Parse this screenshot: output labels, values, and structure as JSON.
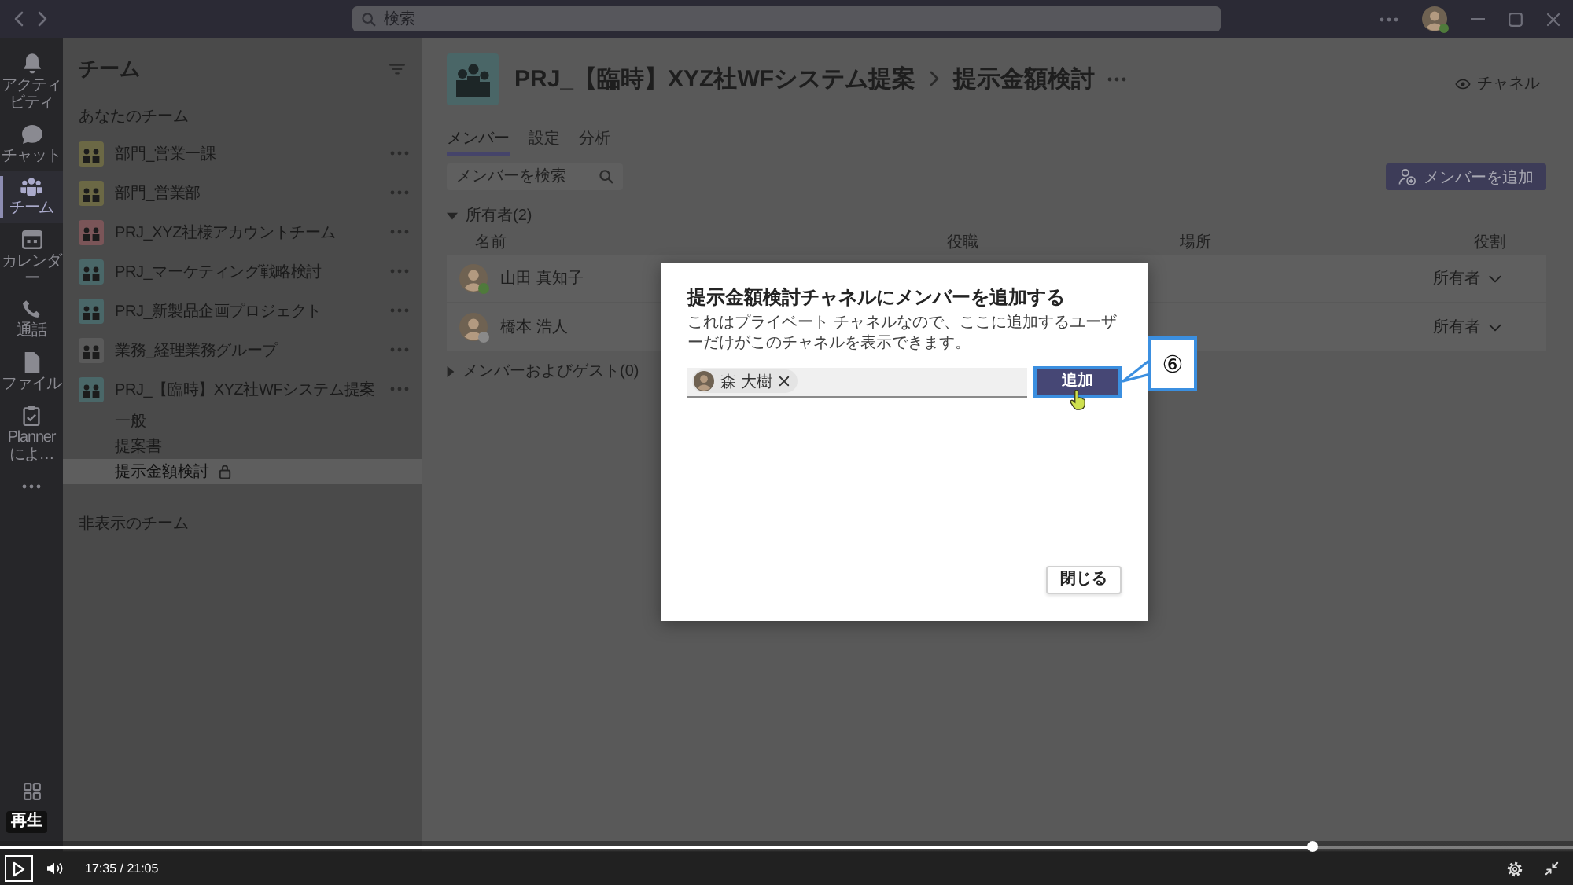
{
  "title_bar": {
    "search": {
      "placeholder": "検索"
    },
    "profile": {
      "color": "#4f7a3b"
    }
  },
  "app_bar": {
    "items": [
      {
        "label": "アクティビティ",
        "selected": false
      },
      {
        "label": "チャット",
        "selected": false
      },
      {
        "label": "チーム",
        "selected": true
      },
      {
        "label": "カレンダー",
        "selected": false
      },
      {
        "label": "通話",
        "selected": false
      },
      {
        "label": "ファイル",
        "selected": false
      },
      {
        "label": "Planner によ…",
        "selected": false
      }
    ]
  },
  "teams_panel": {
    "title": "チーム",
    "section": "あなたのチーム",
    "teams": [
      {
        "name": "部門_営業一課",
        "color": "#6b6845"
      },
      {
        "name": "部門_営業部",
        "color": "#6b6845"
      },
      {
        "name": "PRJ_XYZ社様アカウントチーム",
        "color": "#7a5558"
      },
      {
        "name": "PRJ_マーケティング戦略検討",
        "color": "#4a6768"
      },
      {
        "name": "PRJ_新製品企画プロジェクト",
        "color": "#4a6768"
      },
      {
        "name": "業務_経理業務グループ",
        "color": "#5a5a5a"
      },
      {
        "name": "PRJ_【臨時】XYZ社WFシステム提案",
        "color": "#4a6768",
        "channels": [
          {
            "name": "一般",
            "selected": false,
            "private": false
          },
          {
            "name": "提案書",
            "selected": false,
            "private": false
          },
          {
            "name": "提示金額検討",
            "selected": true,
            "private": true
          }
        ]
      }
    ],
    "hidden_section": "非表示のチーム"
  },
  "channel_header": {
    "team": "PRJ_【臨時】XYZ社WFシステム提案",
    "channel": "提示金額検討",
    "channel_button": "チャネル"
  },
  "tabs": [
    {
      "label": "メンバー",
      "selected": true
    },
    {
      "label": "設定",
      "selected": false
    },
    {
      "label": "分析",
      "selected": false
    }
  ],
  "member_search": {
    "placeholder": "メンバーを検索"
  },
  "add_member_button": "メンバーを追加",
  "owners": {
    "label": "所有者(2)",
    "expanded": true,
    "columns": [
      "名前",
      "役職",
      "場所",
      "役割"
    ],
    "members": [
      {
        "name": "山田 真知子",
        "role": "所有者",
        "color": "#4f7a3b"
      },
      {
        "name": "橋本 浩人",
        "role": "所有者",
        "color": "#8a8a8a"
      }
    ]
  },
  "guests": {
    "label": "メンバーおよびゲスト(0)",
    "expanded": false
  },
  "dialog": {
    "title": "提示金額検討チャネルにメンバーを追加する",
    "description": "これはプライベート チャネルなので、ここに追加するユーザーだけがこのチャネルを表示できます。",
    "chips": [
      {
        "name": "森 大樹"
      }
    ],
    "add_button": "追加",
    "close_button": "閉じる"
  },
  "callout": {
    "label": "⑥"
  },
  "player": {
    "tooltip": "再生",
    "time": "17:35 / 21:05",
    "level": 0.834
  }
}
